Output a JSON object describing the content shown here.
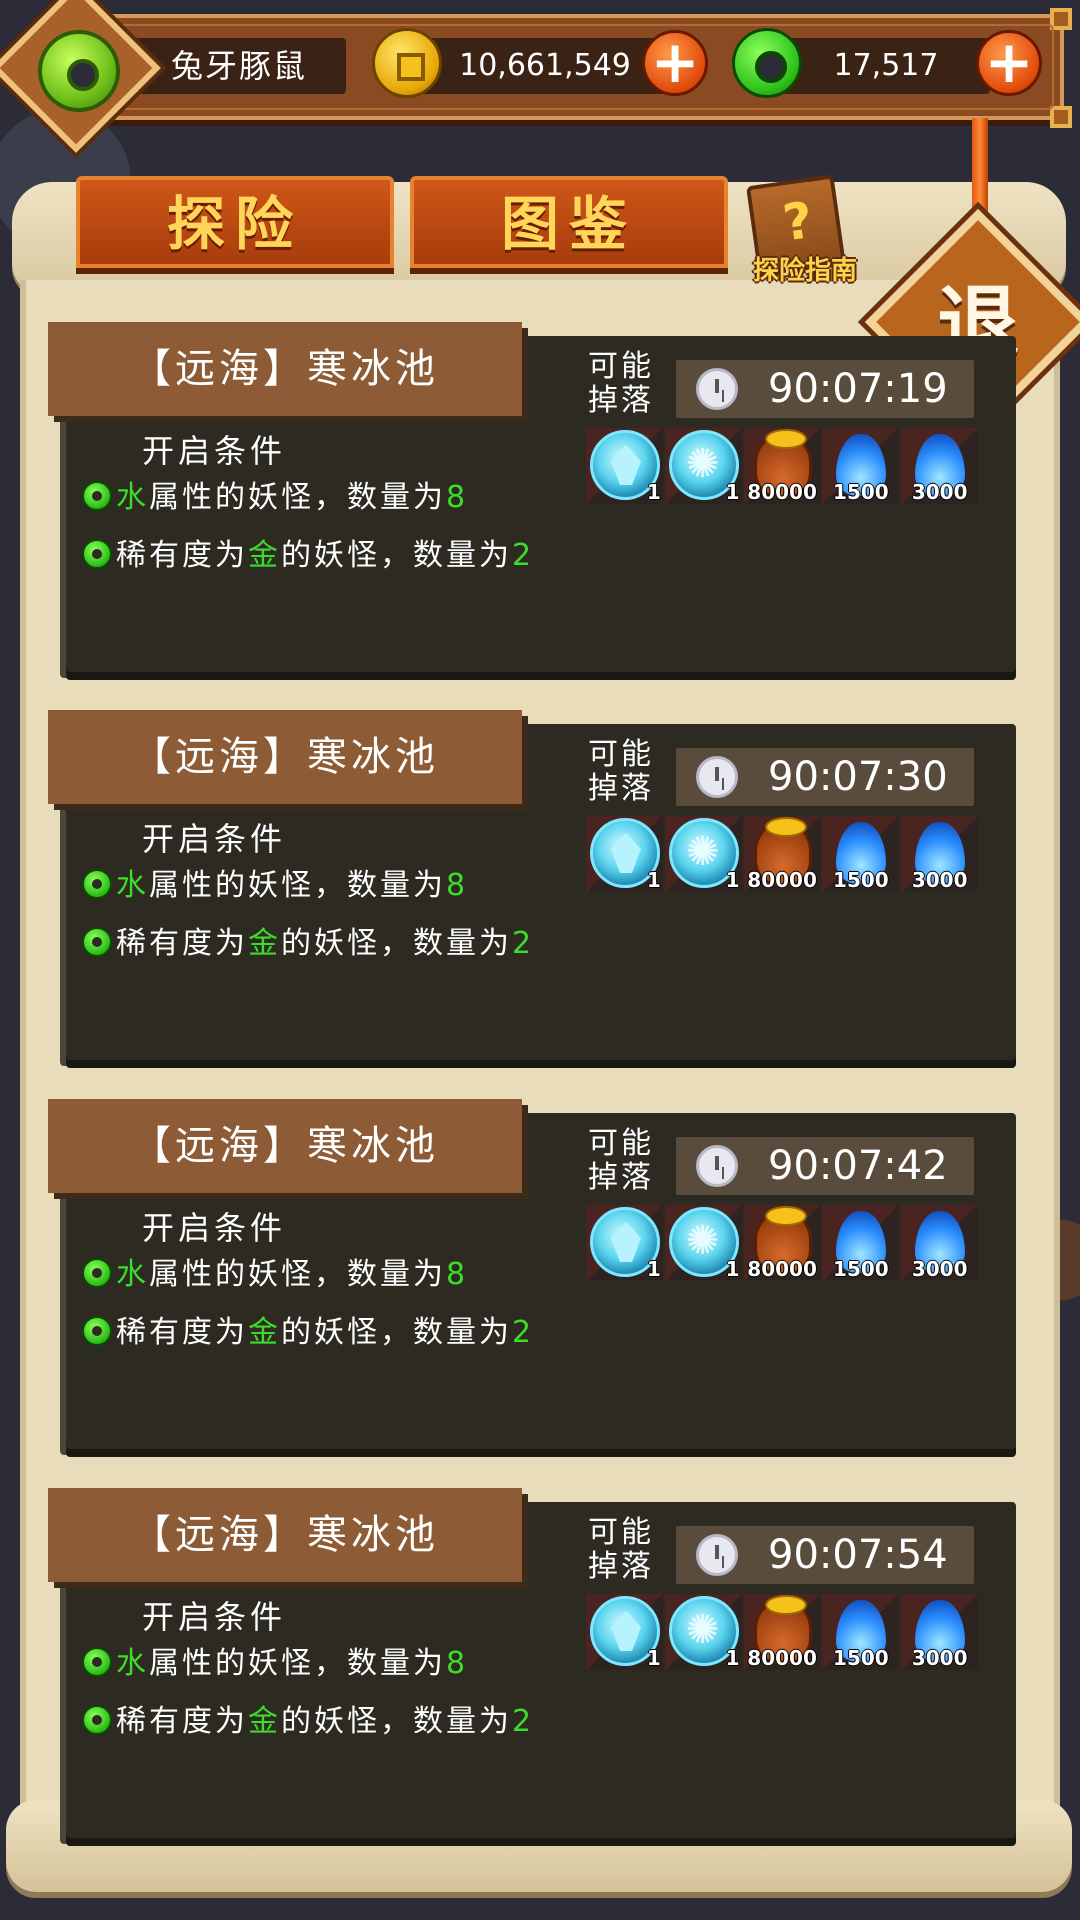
{
  "player": {
    "name": "兔牙豚鼠"
  },
  "currencies": {
    "gold": {
      "value": "10,661,549",
      "icon": "gold-coin-icon"
    },
    "jade": {
      "value": "17,517",
      "icon": "jade-coin-icon"
    }
  },
  "tabs": [
    {
      "label": "探险"
    },
    {
      "label": "图鉴"
    }
  ],
  "guide": {
    "label": "探险指南",
    "glyph": "?"
  },
  "exit": {
    "label": "退"
  },
  "plus_glyph": "+",
  "cards": [
    {
      "title": "【远海】寒冰池",
      "conditions_header": "开启条件",
      "cond1": {
        "attr": "水",
        "text": "属性的妖怪，数量为",
        "count": "8"
      },
      "cond2": {
        "pre": "稀有度为",
        "rarity": "金",
        "text": "的妖怪，数量为",
        "count": "2"
      },
      "drop_label": "可能掉落",
      "timer": "90:07:19",
      "drops": [
        {
          "icon": "ice-crystal-orb-icon",
          "qty": "1"
        },
        {
          "icon": "ice-flake-orb-icon",
          "qty": "1"
        },
        {
          "icon": "money-bag-icon",
          "qty": "80000"
        },
        {
          "icon": "blue-flame-icon",
          "qty": "1500"
        },
        {
          "icon": "blue-flame-icon",
          "qty": "3000"
        }
      ]
    },
    {
      "title": "【远海】寒冰池",
      "conditions_header": "开启条件",
      "cond1": {
        "attr": "水",
        "text": "属性的妖怪，数量为",
        "count": "8"
      },
      "cond2": {
        "pre": "稀有度为",
        "rarity": "金",
        "text": "的妖怪，数量为",
        "count": "2"
      },
      "drop_label": "可能掉落",
      "timer": "90:07:30",
      "drops": [
        {
          "icon": "ice-crystal-orb-icon",
          "qty": "1"
        },
        {
          "icon": "ice-flake-orb-icon",
          "qty": "1"
        },
        {
          "icon": "money-bag-icon",
          "qty": "80000"
        },
        {
          "icon": "blue-flame-icon",
          "qty": "1500"
        },
        {
          "icon": "blue-flame-icon",
          "qty": "3000"
        }
      ]
    },
    {
      "title": "【远海】寒冰池",
      "conditions_header": "开启条件",
      "cond1": {
        "attr": "水",
        "text": "属性的妖怪，数量为",
        "count": "8"
      },
      "cond2": {
        "pre": "稀有度为",
        "rarity": "金",
        "text": "的妖怪，数量为",
        "count": "2"
      },
      "drop_label": "可能掉落",
      "timer": "90:07:42",
      "drops": [
        {
          "icon": "ice-crystal-orb-icon",
          "qty": "1"
        },
        {
          "icon": "ice-flake-orb-icon",
          "qty": "1"
        },
        {
          "icon": "money-bag-icon",
          "qty": "80000"
        },
        {
          "icon": "blue-flame-icon",
          "qty": "1500"
        },
        {
          "icon": "blue-flame-icon",
          "qty": "3000"
        }
      ]
    },
    {
      "title": "【远海】寒冰池",
      "conditions_header": "开启条件",
      "cond1": {
        "attr": "水",
        "text": "属性的妖怪，数量为",
        "count": "8"
      },
      "cond2": {
        "pre": "稀有度为",
        "rarity": "金",
        "text": "的妖怪，数量为",
        "count": "2"
      },
      "drop_label": "可能掉落",
      "timer": "90:07:54",
      "drops": [
        {
          "icon": "ice-crystal-orb-icon",
          "qty": "1"
        },
        {
          "icon": "ice-flake-orb-icon",
          "qty": "1"
        },
        {
          "icon": "money-bag-icon",
          "qty": "80000"
        },
        {
          "icon": "blue-flame-icon",
          "qty": "1500"
        },
        {
          "icon": "blue-flame-icon",
          "qty": "3000"
        }
      ]
    }
  ]
}
